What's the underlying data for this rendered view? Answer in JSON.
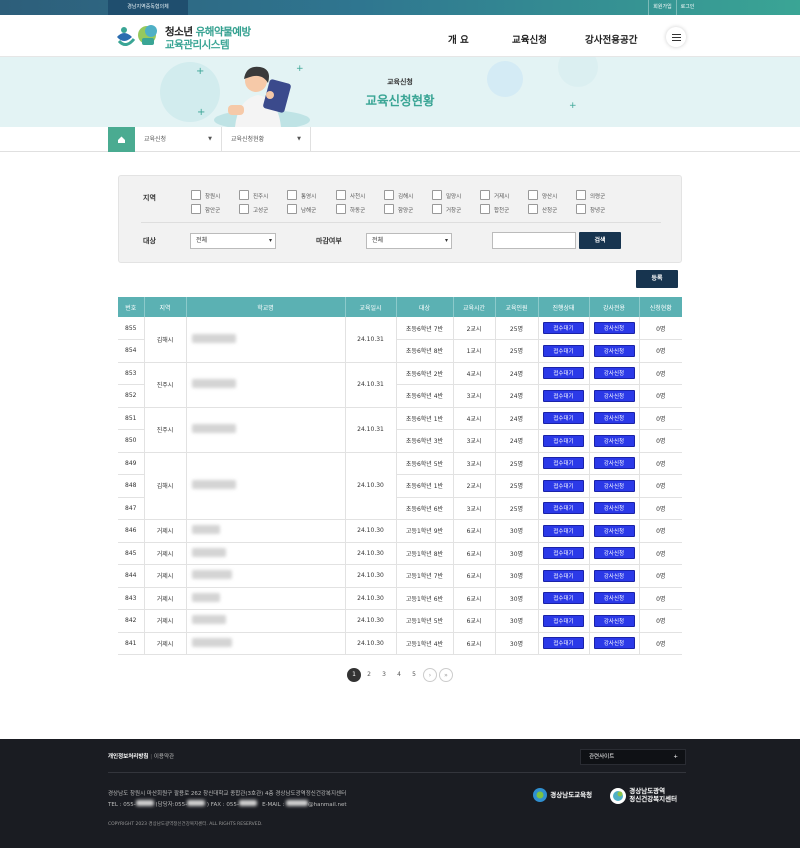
{
  "topbar": {
    "org": "경남지역중독협의체",
    "signup": "회원가입",
    "login": "로그인"
  },
  "logo": {
    "line1_a": "청소년",
    "line1_b": "유해약물예방",
    "line2": "교육관리시스템"
  },
  "nav": {
    "items": [
      "개  요",
      "교육신청",
      "강사전용공간"
    ]
  },
  "banner": {
    "title": "교육신청",
    "heading": "교육신청현황"
  },
  "breadcrumb": {
    "level1": "교육신청",
    "level2": "교육신청현황"
  },
  "search": {
    "region_label": "지역",
    "regions": [
      "창원시",
      "진주시",
      "통영시",
      "사천시",
      "김해시",
      "밀양시",
      "거제시",
      "양산시",
      "의령군",
      "함안군",
      "고성군",
      "남해군",
      "하동군",
      "함양군",
      "거창군",
      "합천군",
      "산청군",
      "창녕군"
    ],
    "target_label": "대상",
    "target_value": "전체",
    "deadline_label": "마감여부",
    "deadline_value": "전체",
    "keyword_value": "",
    "search_button": "검색"
  },
  "register_button": "등록",
  "table": {
    "headers": [
      "번호",
      "지역",
      "학교명",
      "교육일시",
      "대상",
      "교육시간",
      "교육인원",
      "진행상태",
      "강사전용",
      "신청현황"
    ],
    "status_label": "접수대기",
    "instructor_label": "강사신청",
    "rows": [
      {
        "no": "855",
        "target": "초등6학년 7반",
        "hours": "2교시",
        "people": "25명",
        "count": "0명"
      },
      {
        "no": "854",
        "target": "초등6학년 8반",
        "hours": "1교시",
        "people": "25명",
        "count": "0명"
      },
      {
        "no": "853",
        "target": "초등6학년 2반",
        "hours": "4교시",
        "people": "24명",
        "count": "0명"
      },
      {
        "no": "852",
        "target": "초등6학년 4반",
        "hours": "3교시",
        "people": "24명",
        "count": "0명"
      },
      {
        "no": "851",
        "target": "초등6학년 1반",
        "hours": "4교시",
        "people": "24명",
        "count": "0명"
      },
      {
        "no": "850",
        "target": "초등6학년 3반",
        "hours": "3교시",
        "people": "24명",
        "count": "0명"
      },
      {
        "no": "849",
        "target": "초등6학년 5반",
        "hours": "3교시",
        "people": "25명",
        "count": "0명"
      },
      {
        "no": "848",
        "target": "초등6학년 1반",
        "hours": "2교시",
        "people": "25명",
        "count": "0명"
      },
      {
        "no": "847",
        "target": "초등6학년 6반",
        "hours": "3교시",
        "people": "25명",
        "count": "0명"
      },
      {
        "no": "846",
        "region": "거제시",
        "date": "24.10.30",
        "target": "고등1학년 9반",
        "hours": "6교시",
        "people": "30명",
        "count": "0명"
      },
      {
        "no": "845",
        "region": "거제시",
        "date": "24.10.30",
        "target": "고등1학년 8반",
        "hours": "6교시",
        "people": "30명",
        "count": "0명"
      },
      {
        "no": "844",
        "region": "거제시",
        "date": "24.10.30",
        "target": "고등1학년 7반",
        "hours": "6교시",
        "people": "30명",
        "count": "0명"
      },
      {
        "no": "843",
        "region": "거제시",
        "date": "24.10.30",
        "target": "고등1학년 6반",
        "hours": "6교시",
        "people": "30명",
        "count": "0명"
      },
      {
        "no": "842",
        "region": "거제시",
        "date": "24.10.30",
        "target": "고등1학년 5반",
        "hours": "6교시",
        "people": "30명",
        "count": "0명"
      },
      {
        "no": "841",
        "region": "거제시",
        "date": "24.10.30",
        "target": "고등1학년 4반",
        "hours": "6교시",
        "people": "30명",
        "count": "0명"
      }
    ],
    "groups": [
      {
        "region": "김해시",
        "date": "24.10.31"
      },
      {
        "region": "진주시",
        "date": "24.10.31"
      },
      {
        "region": "진주시",
        "date": "24.10.31"
      },
      {
        "region": "김해시",
        "date": "24.10.30"
      }
    ]
  },
  "pagination": {
    "pages": [
      "1",
      "2",
      "3",
      "4",
      "5"
    ],
    "next": "›",
    "last": "»"
  },
  "footer": {
    "privacy": "개인정보처리방침",
    "terms": "이용약관",
    "related": "관련사이트",
    "related_icon": "+",
    "address": "경상남도 창원시 마산회원구 팔용로 262 창신대학교 종합관(3호관) 4층 경상남도광역정신건강복지센터",
    "tel": "TEL : 055-",
    "tel_mid": "(담당자:055-",
    "fax": ") FAX : 055-",
    "email_label": "E-MAIL :",
    "email_domain": "@hanmail.net",
    "copyright": "COPYRIGHT 2023 경상남도광역정신건강복지센터. ALL RIGHTS RESERVED.",
    "logo1": "경상남도교육청",
    "logo2_a": "경상남도광역",
    "logo2_b": "정신건강복지센터"
  }
}
